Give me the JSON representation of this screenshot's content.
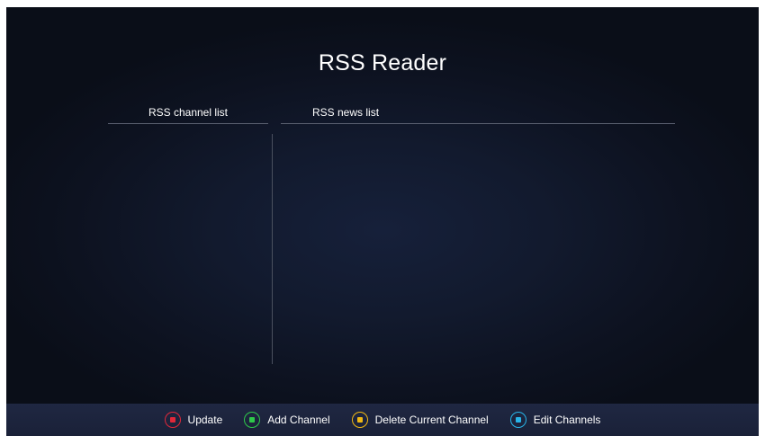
{
  "app": {
    "title": "RSS Reader"
  },
  "columns": {
    "channel_header": "RSS channel list",
    "news_header": "RSS news list"
  },
  "channels": [],
  "news": [],
  "footer": {
    "hints": [
      {
        "label": "Update",
        "color": "#e0283a",
        "key": "red-key-icon"
      },
      {
        "label": "Add Channel",
        "color": "#2ec84a",
        "key": "green-key-icon"
      },
      {
        "label": "Delete Current Channel",
        "color": "#f0b814",
        "key": "yellow-key-icon"
      },
      {
        "label": "Edit Channels",
        "color": "#28b4e8",
        "key": "blue-key-icon"
      }
    ]
  }
}
